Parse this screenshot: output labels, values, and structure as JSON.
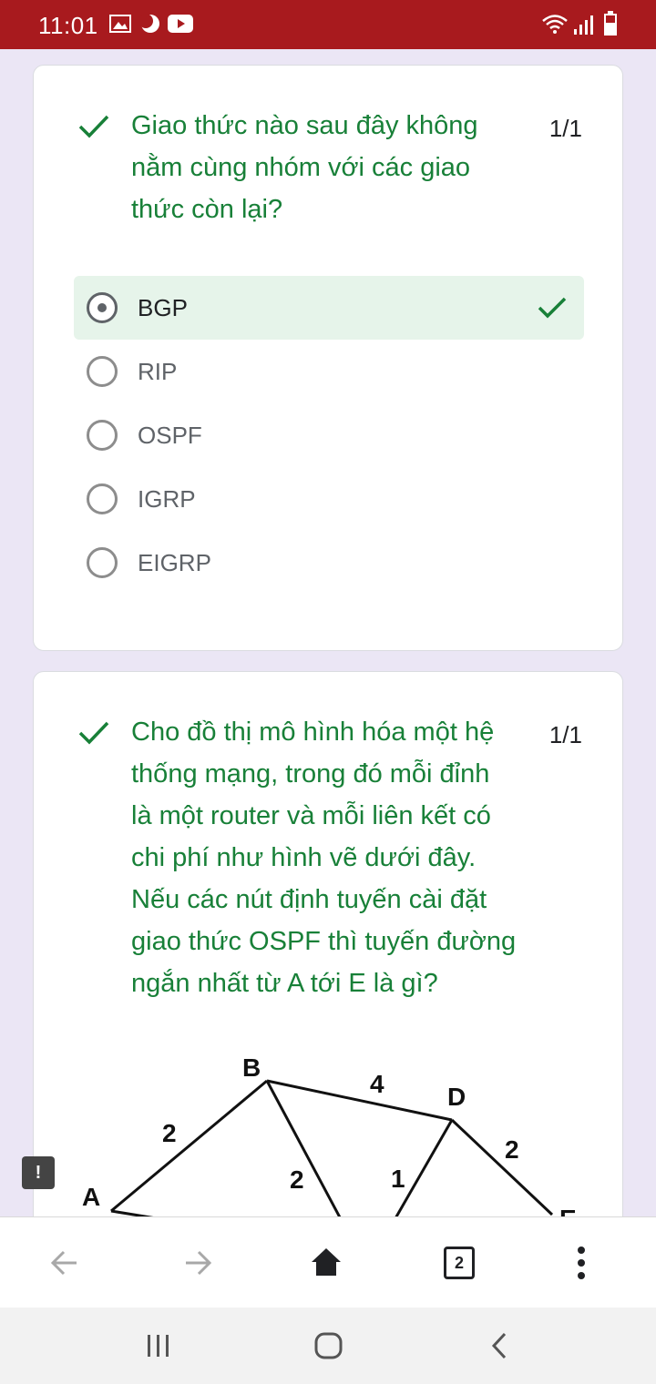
{
  "status_bar": {
    "time": "11:01",
    "icons": [
      "image-icon",
      "moon-icon",
      "youtube-icon"
    ],
    "right_icons": [
      "wifi-icon",
      "signal-icon",
      "battery-icon"
    ]
  },
  "questions": [
    {
      "text": "Giao thức nào sau đây không nằm cùng nhóm với các giao thức còn lại?",
      "lines": [
        "Giao thức nào sau đây không",
        "nằm cùng nhóm với các giao",
        "thức còn lại?"
      ],
      "score": "1/1",
      "options": [
        {
          "label": "BGP",
          "selected": true,
          "correct": true
        },
        {
          "label": "RIP",
          "selected": false
        },
        {
          "label": "OSPF",
          "selected": false
        },
        {
          "label": "IGRP",
          "selected": false
        },
        {
          "label": "EIGRP",
          "selected": false
        }
      ]
    },
    {
      "lines": [
        "Cho đồ thị mô hình hóa một hệ",
        "thống mạng, trong đó mỗi đỉnh",
        "là một router và mỗi liên kết có",
        "chi phí như hình vẽ dưới đây.",
        "Nếu các nút định tuyến cài đặt",
        "giao thức OSPF thì tuyến đường",
        "ngắn nhất từ A tới E là gì?"
      ],
      "score": "1/1",
      "graph": {
        "nodes": [
          "A",
          "B",
          "D",
          "E"
        ],
        "edge_weights": {
          "AB": "2",
          "BD": "4",
          "B_down": "2",
          "D_down": "1",
          "DE": "2"
        }
      }
    }
  ],
  "feedback": {
    "label": "!"
  },
  "browser_bar": {
    "tabs_count": "2"
  },
  "colors": {
    "status_bar": "#a81a1e",
    "correct_green": "#188038",
    "background": "#ebe6f5"
  }
}
